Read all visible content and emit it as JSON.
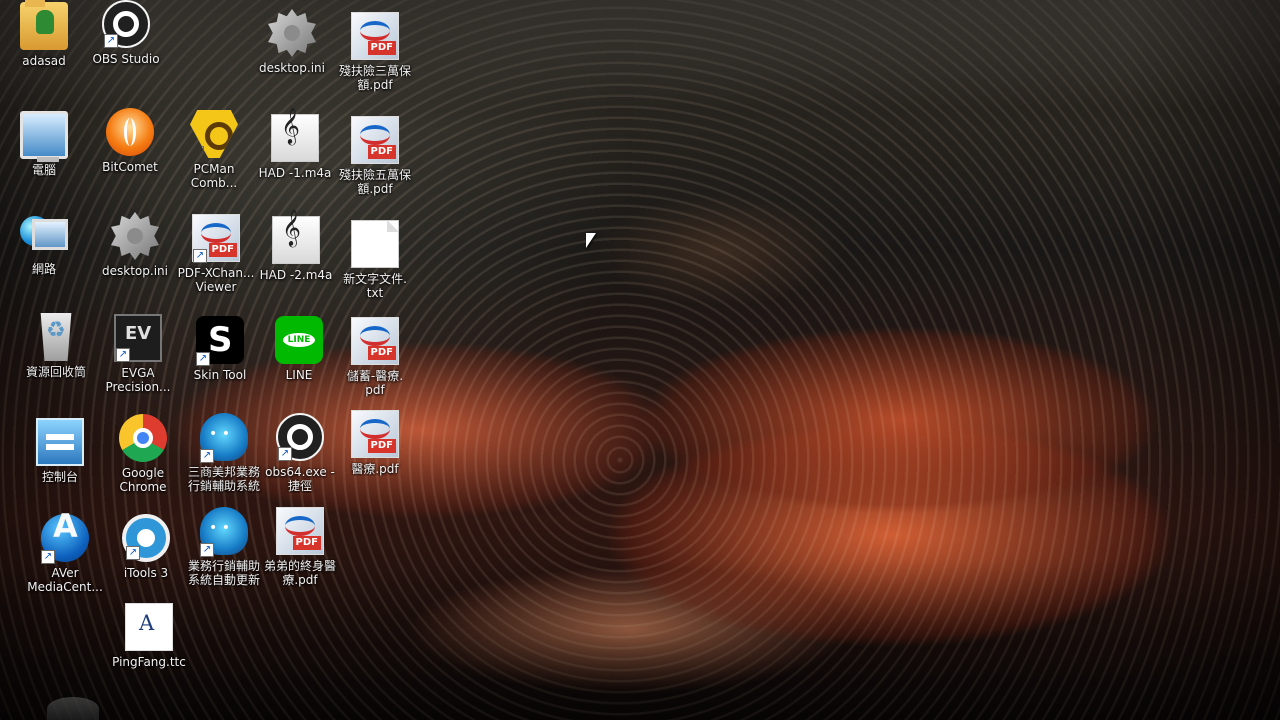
{
  "desktop": {
    "icons": [
      {
        "label": "adasad",
        "icon": "user-folder-icon"
      },
      {
        "label": "OBS Studio",
        "icon": "obs-icon"
      },
      {
        "label": "desktop.ini",
        "icon": "settings-file-icon"
      },
      {
        "label": "殘扶險三萬保\n額.pdf",
        "icon": "pdf-icon"
      },
      {
        "label": "電腦",
        "icon": "computer-icon"
      },
      {
        "label": "BitComet",
        "icon": "bitcomet-icon"
      },
      {
        "label": "PCMan\nComb...",
        "icon": "pcman-icon"
      },
      {
        "label": "HAD -1.m4a",
        "icon": "audio-file-icon"
      },
      {
        "label": "殘扶險五萬保\n額.pdf",
        "icon": "pdf-icon"
      },
      {
        "label": "網路",
        "icon": "network-icon"
      },
      {
        "label": "desktop.ini",
        "icon": "settings-file-icon"
      },
      {
        "label": "PDF-XChan...\nViewer",
        "icon": "pdf-viewer-icon"
      },
      {
        "label": "HAD -2.m4a",
        "icon": "audio-file-icon"
      },
      {
        "label": "新文字文件.\ntxt",
        "icon": "text-file-icon"
      },
      {
        "label": "資源回收筒",
        "icon": "recycle-bin-icon"
      },
      {
        "label": "EVGA\nPrecision...",
        "icon": "evga-icon"
      },
      {
        "label": "Skin Tool",
        "icon": "skin-tool-icon"
      },
      {
        "label": "LINE",
        "icon": "line-app-icon"
      },
      {
        "label": "儲蓄-醫療.\npdf",
        "icon": "pdf-icon"
      },
      {
        "label": "控制台",
        "icon": "control-panel-icon"
      },
      {
        "label": "Google\nChrome",
        "icon": "chrome-icon"
      },
      {
        "label": "三商美邦業務\n行銷輔助系統",
        "icon": "robot-app-icon"
      },
      {
        "label": "obs64.exe -\n捷徑",
        "icon": "obs-icon"
      },
      {
        "label": "醫療.pdf",
        "icon": "pdf-icon"
      },
      {
        "label": "AVer\nMediaCent...",
        "icon": "aver-media-icon"
      },
      {
        "label": "iTools 3",
        "icon": "itools-icon"
      },
      {
        "label": "業務行銷輔助\n系統自動更新",
        "icon": "robot-app-icon"
      },
      {
        "label": "弟弟的終身醫\n療.pdf",
        "icon": "pdf-icon"
      },
      {
        "label": "PingFang.ttc",
        "icon": "font-file-icon"
      }
    ]
  }
}
